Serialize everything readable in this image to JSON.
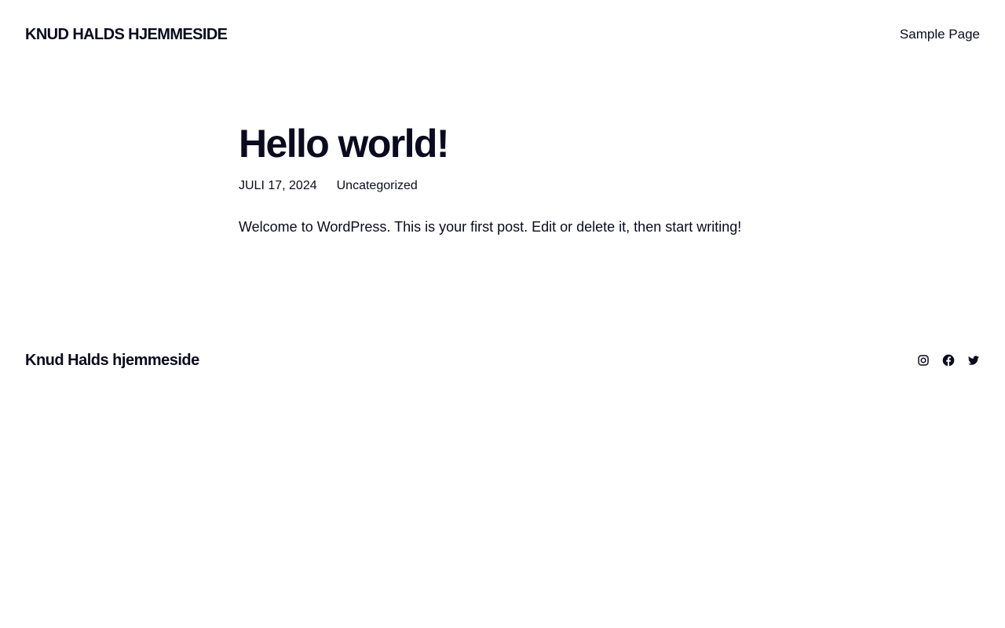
{
  "header": {
    "site_title": "KNUD HALDS HJEMMESIDE",
    "nav": [
      {
        "label": "Sample Page"
      }
    ]
  },
  "post": {
    "title": "Hello world!",
    "date": "JULI 17, 2024",
    "category": "Uncategorized",
    "content": "Welcome to WordPress. This is your first post. Edit or delete it, then start writing!"
  },
  "footer": {
    "site_title": "Knud Halds hjemmeside",
    "social": [
      {
        "icon": "instagram-icon"
      },
      {
        "icon": "facebook-icon"
      },
      {
        "icon": "twitter-icon"
      }
    ]
  },
  "colors": {
    "text": "#0b0a1f",
    "background": "#ffffff"
  }
}
